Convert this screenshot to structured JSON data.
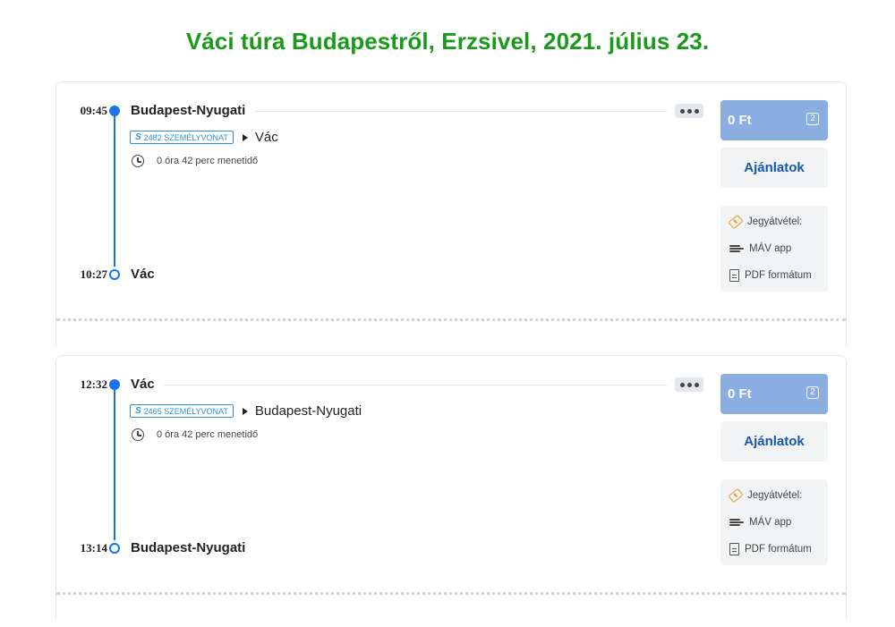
{
  "page": {
    "title": "Váci túra Budapestről, Erzsivel, 2021. július 23."
  },
  "journeys": [
    {
      "departure_time": "09:45",
      "departure_station": "Budapest-Nyugati",
      "train_badge": "2482 SZEMÉLYVONAT",
      "train_logo": "S",
      "destination": "Vác",
      "duration": "0 óra 42 perc  menetidő",
      "arrival_time": "10:27",
      "arrival_station": "Vác",
      "price": "0 Ft",
      "count": "2",
      "offers_label": "Ajánlatok",
      "ticket_label": "Jegyátvétel:",
      "app_label": "MÁV app",
      "pdf_label": "PDF formátum"
    },
    {
      "departure_time": "12:32",
      "departure_station": "Vác",
      "train_badge": "2465 SZEMÉLYVONAT",
      "train_logo": "S",
      "destination": "Budapest-Nyugati",
      "duration": "0 óra 42 perc  menetidő",
      "arrival_time": "13:14",
      "arrival_station": "Budapest-Nyugati",
      "price": "0 Ft",
      "count": "2",
      "offers_label": "Ajánlatok",
      "ticket_label": "Jegyátvétel:",
      "app_label": "MÁV app",
      "pdf_label": "PDF formátum"
    }
  ],
  "colors": {
    "title": "#1a9a1a",
    "route_line": "#1a73e8",
    "price_button": "#8aaee0",
    "offers_text": "#1657a8",
    "ticket_icon": "#e79b2e"
  },
  "icons": [
    "more-icon",
    "train-logo-icon",
    "arrow-right-icon",
    "clock-icon",
    "ticket-icon",
    "train-app-icon",
    "pdf-icon"
  ]
}
